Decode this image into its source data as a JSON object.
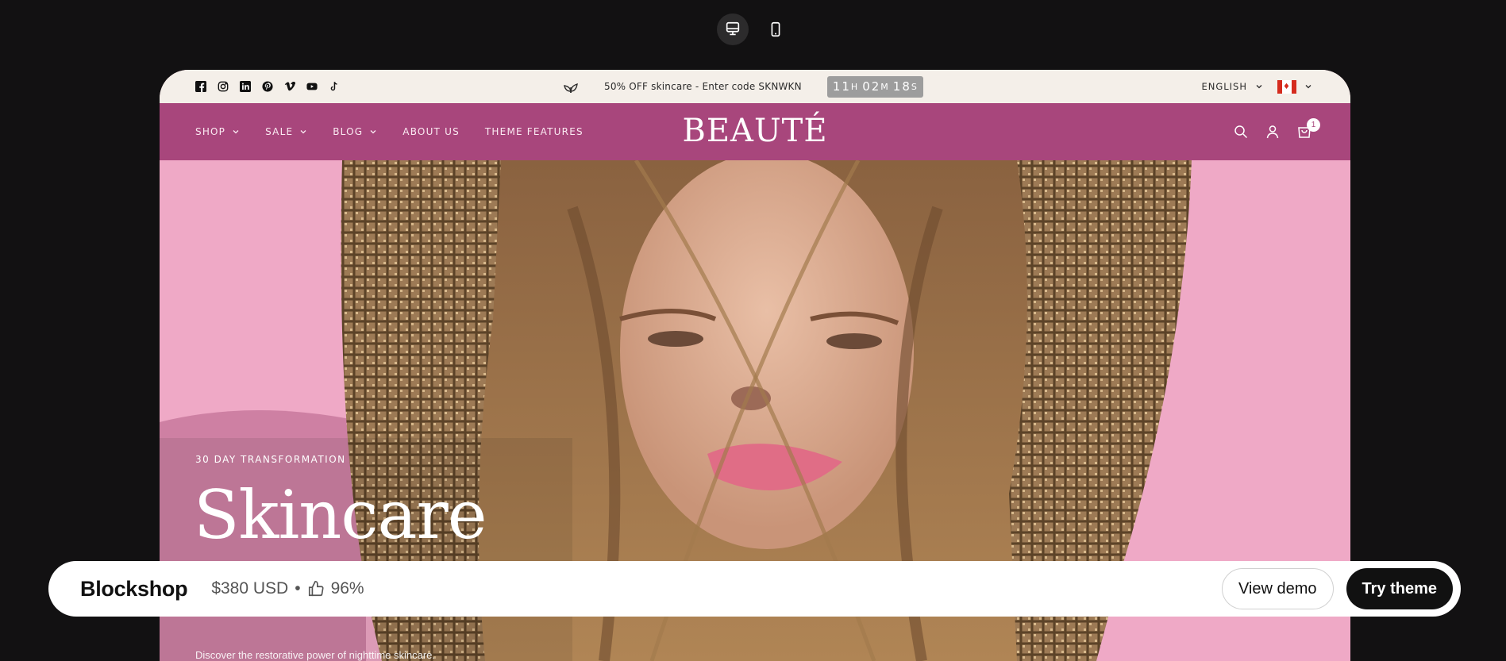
{
  "device_toggle": {
    "desktop_icon": "desktop-icon",
    "mobile_icon": "mobile-icon"
  },
  "announcement": {
    "socials": [
      "facebook-icon",
      "instagram-icon",
      "linkedin-icon",
      "pinterest-icon",
      "vimeo-icon",
      "youtube-icon",
      "tiktok-icon"
    ],
    "promo_text": "50% OFF skincare - Enter code SKNWKN",
    "countdown": {
      "hours": "11",
      "hours_unit": "H",
      "minutes": "02",
      "minutes_unit": "M",
      "seconds": "18",
      "seconds_unit": "S"
    },
    "language": "ENGLISH",
    "country_flag": "canada-flag-icon"
  },
  "header": {
    "logo": "BEAUTÉ",
    "nav": [
      {
        "label": "SHOP",
        "dropdown": true
      },
      {
        "label": "SALE",
        "dropdown": true
      },
      {
        "label": "BLOG",
        "dropdown": true
      },
      {
        "label": "ABOUT US",
        "dropdown": false
      },
      {
        "label": "THEME FEATURES",
        "dropdown": false
      }
    ],
    "cart_count": "1"
  },
  "hero": {
    "eyebrow": "30 DAY TRANSFORMATION",
    "title": "Skincare",
    "subtitle": "Discover the restorative power of nighttime skincare."
  },
  "theme_bar": {
    "name": "Blockshop",
    "price": "$380 USD",
    "separator": "•",
    "rating": "96%",
    "view_demo": "View demo",
    "try_theme": "Try theme"
  },
  "colors": {
    "header": "#a8467c",
    "announcement_bg": "#f4efe9",
    "hero_bg": "#f0aac8",
    "page_bg": "#121112"
  }
}
